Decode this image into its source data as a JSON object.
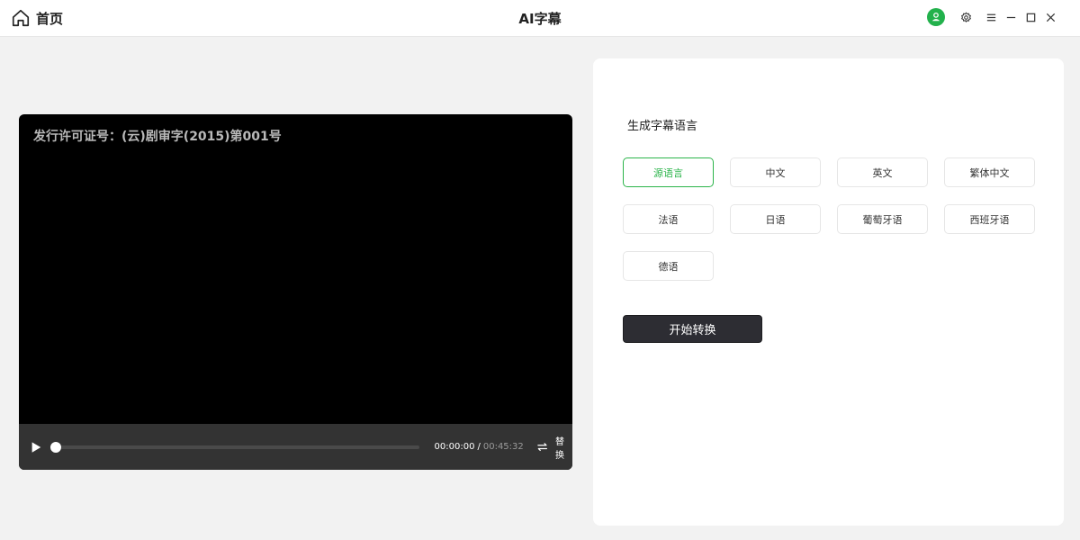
{
  "titlebar": {
    "home_label": "首页",
    "app_title": "AI字幕",
    "icons": [
      "home-icon",
      "avatar-icon",
      "gear-icon",
      "menu-icon",
      "minimize-icon",
      "maximize-icon",
      "close-icon"
    ],
    "avatar_color": "#22b14c"
  },
  "player": {
    "watermark": "发行许可证号：(云)剧审字(2015)第001号",
    "current_time": "00:00:00",
    "separator": "/",
    "total_time": "00:45:32",
    "progress": 0,
    "replace_label": "替换"
  },
  "panel": {
    "title": "生成字幕语言",
    "languages": [
      "源语言",
      "中文",
      "英文",
      "繁体中文",
      "法语",
      "日语",
      "葡萄牙语",
      "西班牙语",
      "德语"
    ],
    "selected_index": 0,
    "accent_color": "#2bb44a",
    "start_label": "开始转换"
  }
}
